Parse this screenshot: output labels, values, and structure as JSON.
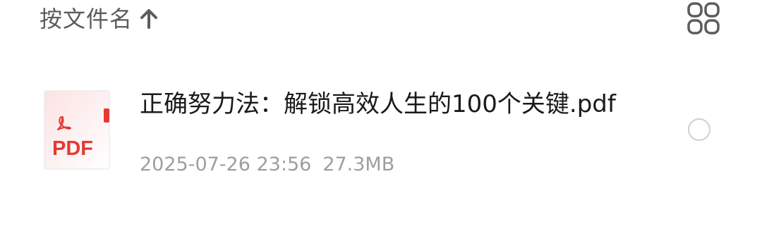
{
  "sort": {
    "label": "按文件名",
    "direction_icon": "arrow-up-icon"
  },
  "view_toggle": {
    "icon": "grid-view-icon"
  },
  "files": [
    {
      "name": "正确努力法：解锁高效人生的100个关键.pdf",
      "type_badge": "PDF",
      "icon": "pdf-file-icon",
      "date": "2025-07-26 23:56",
      "size": "27.3MB",
      "selected": false
    }
  ],
  "colors": {
    "pdf_red": "#e53935",
    "text_primary": "#1a1a1a",
    "text_secondary": "#9e9e9e",
    "header_text": "#5c5c5c"
  }
}
